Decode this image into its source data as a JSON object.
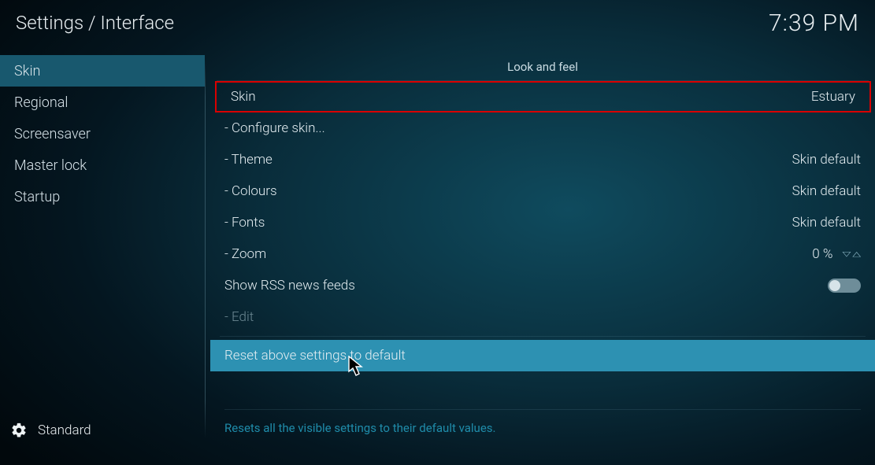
{
  "header": {
    "breadcrumb": "Settings / Interface",
    "time": "7:39 PM"
  },
  "sidebar": {
    "items": [
      {
        "label": "Skin",
        "selected": true
      },
      {
        "label": "Regional",
        "selected": false
      },
      {
        "label": "Screensaver",
        "selected": false
      },
      {
        "label": "Master lock",
        "selected": false
      },
      {
        "label": "Startup",
        "selected": false
      }
    ],
    "level": "Standard"
  },
  "panel": {
    "section_title": "Look and feel",
    "rows": [
      {
        "label": "Skin",
        "value": "Estuary",
        "highlight": true
      },
      {
        "label": "- Configure skin..."
      },
      {
        "label": "- Theme",
        "value": "Skin default"
      },
      {
        "label": "- Colours",
        "value": "Skin default"
      },
      {
        "label": "- Fonts",
        "value": "Skin default"
      },
      {
        "label": "- Zoom",
        "value": "0 %",
        "spinner": true
      },
      {
        "label": "Show RSS news feeds",
        "toggle": true,
        "toggle_on": false
      },
      {
        "label": "- Edit",
        "disabled": true
      },
      {
        "label": "Reset above settings to default",
        "hovered": true
      }
    ],
    "hint": "Resets all the visible settings to their default values."
  }
}
